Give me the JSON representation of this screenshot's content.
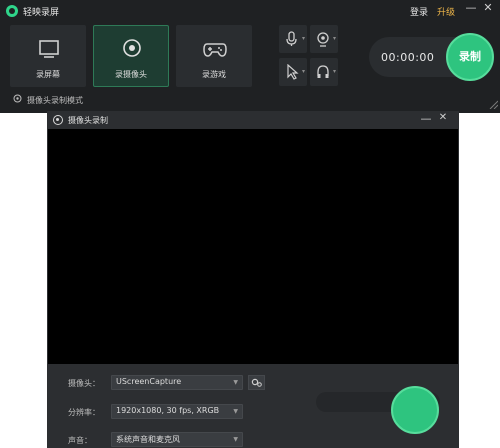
{
  "app": {
    "title": "轻映录屏",
    "login": "登录",
    "upgrade": "升级",
    "min": "—",
    "close": "✕",
    "modes": [
      {
        "label": "录屏幕",
        "icon": "monitor-icon",
        "active": false
      },
      {
        "label": "录摄像头",
        "icon": "webcam-icon",
        "active": true
      },
      {
        "label": "录游戏",
        "icon": "gamepad-icon",
        "active": false
      }
    ],
    "tools": {
      "mic": "microphone-icon",
      "camera": "camera-icon",
      "cursor": "cursor-icon",
      "audio": "headphones-icon"
    },
    "timer": "00:00:00",
    "record_label": "录制",
    "hint": "摄像头录制模式",
    "accent": "#2ec47f",
    "upgrade_color": "#f1b84a"
  },
  "camera_window": {
    "title": "摄像头录制",
    "min": "—",
    "close": "✕",
    "fields": {
      "camera_label": "摄像头：",
      "camera_value": "UScreenCapture",
      "resolution_label": "分辨率：",
      "resolution_value": "1920x1080, 30 fps, XRGB",
      "sound_label": "声音：",
      "sound_value": "系统声音和麦克风"
    }
  }
}
